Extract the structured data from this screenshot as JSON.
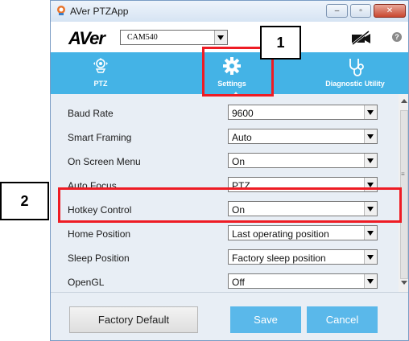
{
  "window": {
    "title": "AVer PTZApp"
  },
  "toolbar": {
    "logo": "AVer",
    "camera_select": "CAM540",
    "novideo_icon": "camera-off-icon",
    "help_icon": "help-icon"
  },
  "tabs": [
    {
      "label": "PTZ",
      "icon": "ptz-icon"
    },
    {
      "label": "Settings",
      "icon": "gear-icon"
    },
    {
      "label": "Diagnostic Utility",
      "icon": "stethoscope-icon"
    }
  ],
  "settings": [
    {
      "label": "Baud Rate",
      "value": "9600"
    },
    {
      "label": "Smart Framing",
      "value": "Auto"
    },
    {
      "label": "On Screen Menu",
      "value": "On"
    },
    {
      "label": "Auto Focus",
      "value": "PTZ"
    },
    {
      "label": "Hotkey Control",
      "value": "On"
    },
    {
      "label": "Home Position",
      "value": "Last operating position"
    },
    {
      "label": "Sleep Position",
      "value": "Factory sleep position"
    },
    {
      "label": "OpenGL",
      "value": "Off"
    }
  ],
  "buttons": {
    "factory_default": "Factory Default",
    "save": "Save",
    "cancel": "Cancel"
  },
  "callouts": [
    "1",
    "2"
  ],
  "colors": {
    "tab_bar": "#44b3e6",
    "highlight": "#ee1c24",
    "blue_button": "#5ab8ea"
  }
}
